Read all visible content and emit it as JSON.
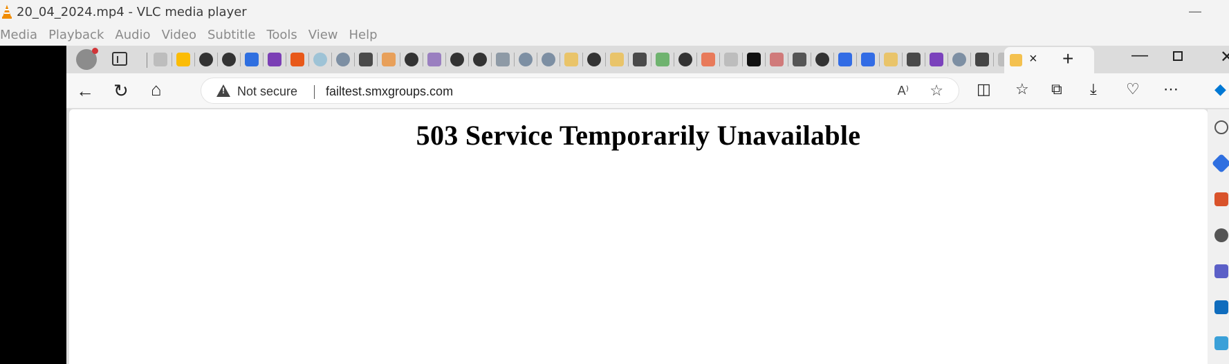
{
  "vlc": {
    "title": "20_04_2024.mp4 - VLC media player",
    "menu": [
      "Media",
      "Playback",
      "Audio",
      "Video",
      "Subtitle",
      "Tools",
      "View",
      "Help"
    ]
  },
  "browser": {
    "tab_favicons": [
      "page-icon",
      "google-icon",
      "github-icon",
      "github-icon",
      "bootstrap-icon",
      "purple-app-icon",
      "orange-app-icon",
      "circle-icon",
      "docker-icon",
      "hashicorp-icon",
      "package-icon",
      "github-icon",
      "dotnet-icon",
      "github-icon",
      "github-icon",
      "box-icon",
      "docker-icon",
      "docker-icon",
      "folder-icon",
      "github-icon",
      "folder-icon",
      "hashicorp-icon",
      "green-icon",
      "github-icon",
      "ember-icon",
      "page-icon",
      "medium-icon",
      "dots-icon",
      "aws-icon",
      "github-icon",
      "kubernetes-icon",
      "kubernetes-icon",
      "folder-icon",
      "hashicorp-icon",
      "terraform-icon",
      "docker-icon",
      "wave-icon",
      "page-icon"
    ],
    "active_tab_close": "×",
    "new_tab": "+",
    "address": {
      "security_label": "Not secure",
      "url": "failtest.smxgroups.com",
      "read_aloud": "A⁾"
    },
    "colors": {
      "accent": "#0078d4",
      "warning": "#444444"
    }
  },
  "page": {
    "heading": "503 Service Temporarily Unavailable"
  }
}
